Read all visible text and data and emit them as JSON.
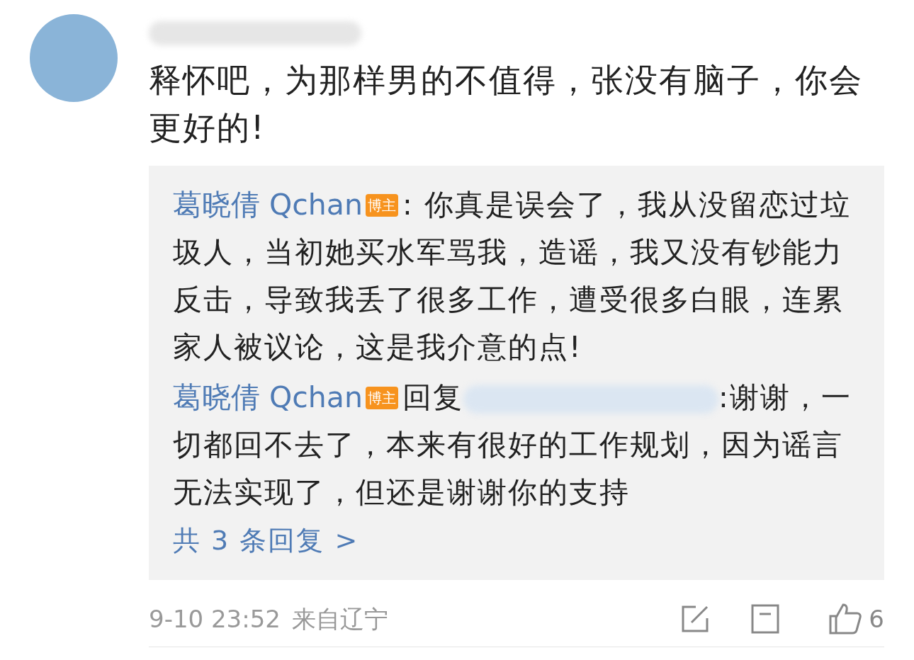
{
  "comment": {
    "text": "释怀吧，为那样男的不值得，张没有脑子，你会更好的!",
    "replies": [
      {
        "kind": "comment",
        "author": "葛晓倩 Qchan",
        "badge": "博主",
        "text": ": 你真是误会了，我从没留恋过垃圾人，当初她买水军骂我，造谣，我又没有钞能力反击，导致我丢了很多工作，遭受很多白眼，连累家人被议论，这是我介意的点!"
      },
      {
        "kind": "reply",
        "author": "葛晓倩 Qchan",
        "badge": "博主",
        "reply_word": "回复",
        "text": ":谢谢，一切都回不去了，本来有很好的工作规划，因为谣言无法实现了，但还是谢谢你的支持"
      }
    ],
    "more_replies": "共 3 条回复 >",
    "time": "9-10 23:52",
    "location": "来自辽宁",
    "like_count": "6"
  }
}
